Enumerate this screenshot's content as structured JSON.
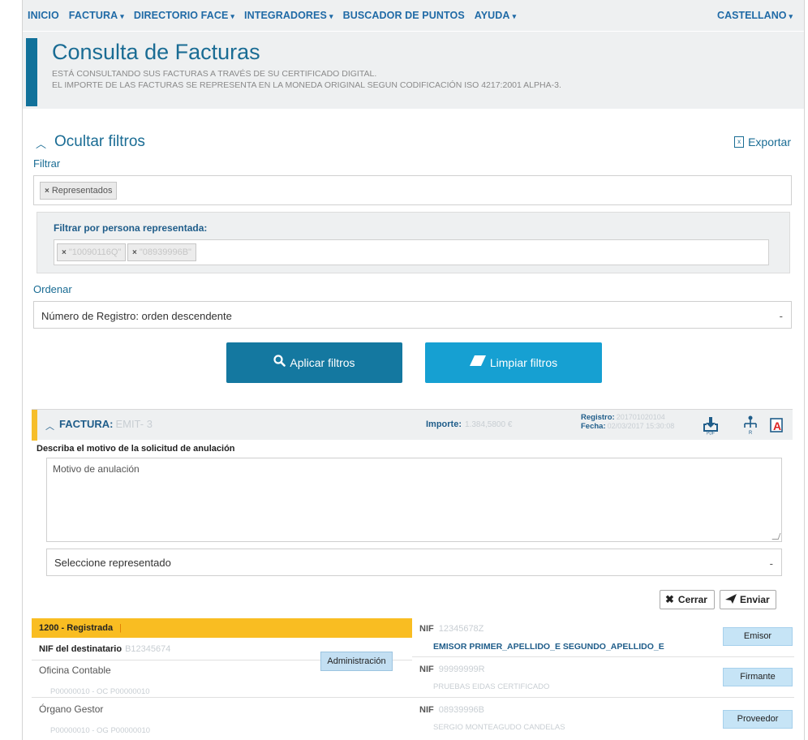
{
  "nav": {
    "items": [
      {
        "label": "INICIO",
        "caret": false
      },
      {
        "label": "FACTURA",
        "caret": true
      },
      {
        "label": "DIRECTORIO FACE",
        "caret": true
      },
      {
        "label": "INTEGRADORES",
        "caret": true
      },
      {
        "label": "BUSCADOR DE PUNTOS",
        "caret": false
      },
      {
        "label": "AYUDA",
        "caret": true
      }
    ],
    "language": "CASTELLANO"
  },
  "header": {
    "title": "Consulta de Facturas",
    "line1": "ESTÁ CONSULTANDO SUS FACTURAS A TRAVÉS DE SU CERTIFICADO DIGITAL.",
    "line2": "EL IMPORTE DE LAS FACTURAS SE REPRESENTA EN LA MONEDA ORIGINAL SEGUN CODIFICACIÓN ISO 4217:2001 ALPHA-3."
  },
  "filters": {
    "toggle_label": "Ocultar filtros",
    "export_label": "Exportar",
    "filtrar_label": "Filtrar",
    "active_tag": "Representados",
    "represented_title": "Filtrar por persona representada:",
    "represented_tags": [
      "\"10090116Q\"",
      "\"08939996B\""
    ],
    "ordenar_label": "Ordenar",
    "ordenar_value": "Número de Registro: orden descendente",
    "apply_label": "Aplicar filtros",
    "clear_label": "Limpiar filtros"
  },
  "invoice": {
    "title_label": "FACTURA:",
    "number": "EMIT- 3",
    "importe_label": "Importe:",
    "importe_value": "1.384,5800 €",
    "registro_label": "Registro:",
    "registro_value": "201701020104",
    "fecha_label": "Fecha:",
    "fecha_value": "02/03/2017 15:30:08",
    "cancel_prompt": "Describa el motivo de la solicitud de anulación",
    "cancel_placeholder": "Motivo de anulación",
    "select_placeholder": "Seleccione representado",
    "close_label": "Cerrar",
    "send_label": "Enviar",
    "status": "1200 - Registrada",
    "recipient_nif_label": "NIF del destinatario",
    "recipient_nif_value": "B12345674",
    "admin_button": "Administración",
    "oficina_label": "Oficina Contable",
    "oficina_value": "P00000010 - OC P00000010",
    "organo_label": "Órgano Gestor",
    "organo_value": "P00000010 - OG P00000010",
    "parties": [
      {
        "nif_label": "NIF",
        "nif": "12345678Z",
        "name": "EMISOR PRIMER_APELLIDO_E SEGUNDO_APELLIDO_E",
        "role": "Emisor"
      },
      {
        "nif_label": "NIF",
        "nif": "99999999R",
        "name": "PRUEBAS EIDAS CERTIFICADO",
        "role": "Firmante"
      },
      {
        "nif_label": "NIF",
        "nif": "08939996B",
        "name": "SERGIO MONTEAGUDO CANDELAS",
        "role": "Proveedor"
      }
    ]
  }
}
